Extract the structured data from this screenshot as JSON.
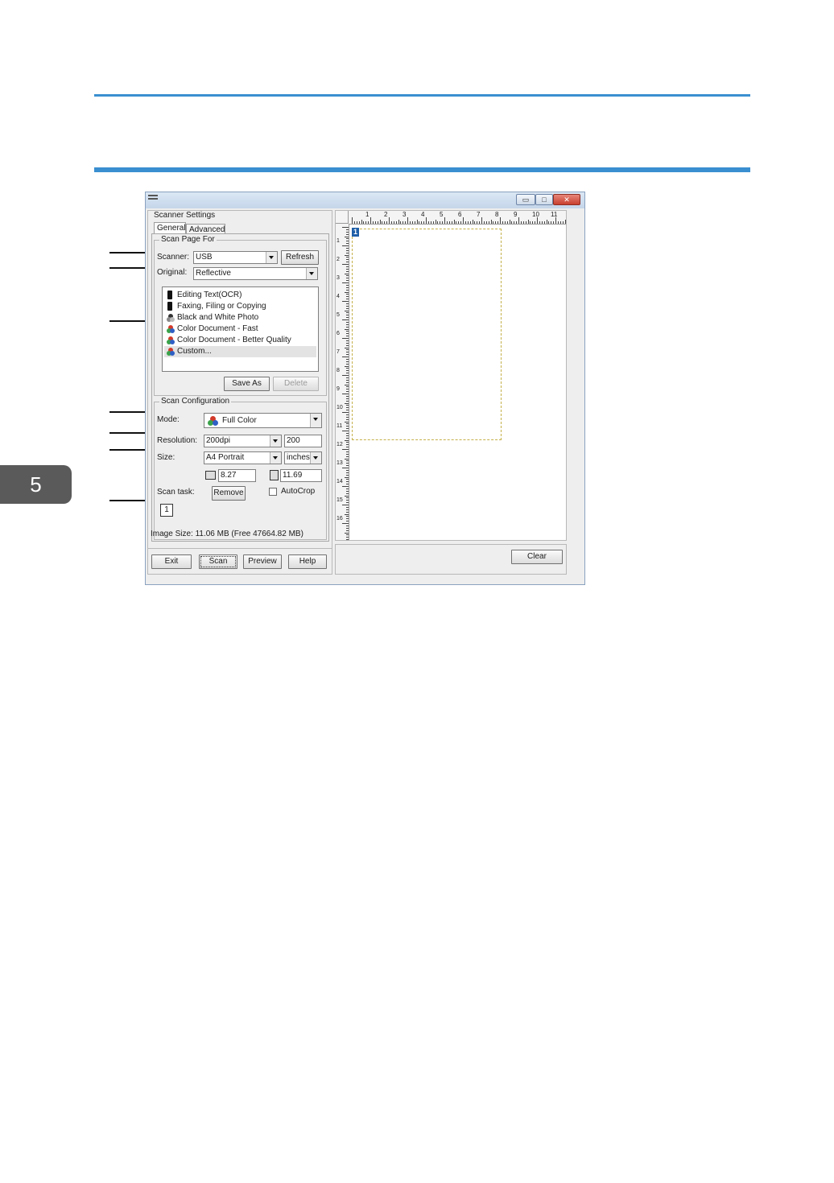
{
  "chapter": {
    "number": "5"
  },
  "window": {
    "controls": {
      "minimize": "▭",
      "maximize": "□",
      "close": "✕"
    },
    "group_title": "Scanner Settings",
    "tabs": [
      "General",
      "Advanced"
    ],
    "scan_page_for": {
      "title": "Scan Page For",
      "scanner_label": "Scanner:",
      "scanner_value": "USB",
      "refresh_label": "Refresh",
      "original_label": "Original:",
      "original_value": "Reflective",
      "presets": [
        {
          "label": "Editing Text(OCR)",
          "icon": "monochrome-icon"
        },
        {
          "label": "Faxing, Filing or Copying",
          "icon": "monochrome-icon"
        },
        {
          "label": "Black and White Photo",
          "icon": "grayscale-icon"
        },
        {
          "label": "Color Document - Fast",
          "icon": "color-icon"
        },
        {
          "label": "Color Document - Better Quality",
          "icon": "color-icon"
        },
        {
          "label": "Custom...",
          "icon": "color-icon",
          "selected": true
        }
      ],
      "save_as_label": "Save As",
      "delete_label": "Delete"
    },
    "scan_configuration": {
      "title": "Scan Configuration",
      "mode_label": "Mode:",
      "mode_value": "Full Color",
      "resolution_label": "Resolution:",
      "resolution_value": "200dpi",
      "resolution_custom": "200",
      "size_label": "Size:",
      "size_value": "A4 Portrait",
      "unit_value": "inches",
      "width_value": "8.27",
      "height_value": "11.69",
      "scan_task_label": "Scan task:",
      "remove_label": "Remove",
      "autocrop_label": "AutoCrop",
      "autocrop_checked": false,
      "task_number": "1"
    },
    "image_size": "Image Size: 11.06 MB (Free 47664.82 MB)",
    "buttons": {
      "exit": "Exit",
      "scan": "Scan",
      "preview": "Preview",
      "help": "Help",
      "clear": "Clear"
    },
    "preview": {
      "h_ruler_labels": [
        "1",
        "2",
        "3",
        "4",
        "5",
        "6",
        "7",
        "8",
        "9",
        "10",
        "11"
      ],
      "v_ruler_labels": [
        "1",
        "2",
        "3",
        "4",
        "5",
        "6",
        "7",
        "8",
        "9",
        "10",
        "11",
        "12",
        "13",
        "14",
        "15",
        "16"
      ],
      "area_badge": "1"
    }
  },
  "colors": {
    "accent_rule": "#3a8fd0",
    "chapter_tab": "#5a5a5a",
    "scan_area_border": "#c4b04a",
    "selection_badge": "#1f5fa8"
  }
}
